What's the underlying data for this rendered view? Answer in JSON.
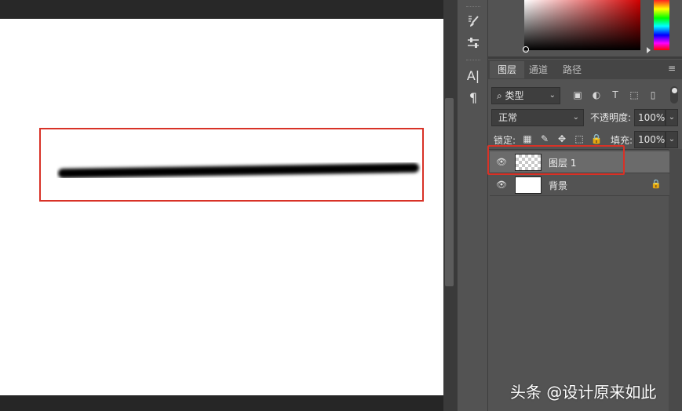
{
  "tool_strip": {
    "tools": [
      {
        "icon": "brush-settings-icon",
        "glyph": "🖌"
      },
      {
        "icon": "adjust-icon",
        "glyph": "⚙"
      },
      {
        "icon": "character-icon",
        "glyph": "A|"
      },
      {
        "icon": "paragraph-icon",
        "glyph": "¶"
      }
    ]
  },
  "panel_tabs": {
    "layers": "图层",
    "channels": "通道",
    "paths": "路径",
    "menu_glyph": "≡"
  },
  "filter": {
    "kind_label": "⌕ 类型",
    "icons": [
      "▣",
      "◐",
      "T",
      "⬚",
      "▯"
    ]
  },
  "blend": {
    "mode": "正常",
    "opacity_label": "不透明度:",
    "opacity_value": "100%"
  },
  "lock": {
    "label": "锁定:",
    "icons": [
      "▦",
      "✎",
      "✥",
      "⬚",
      "🔒"
    ],
    "fill_label": "填充:",
    "fill_value": "100%"
  },
  "layers": [
    {
      "name": "图层 1",
      "visible_glyph": "👁",
      "selected": true
    },
    {
      "name": "背景",
      "visible_glyph": "👁",
      "locked_glyph": "🔒",
      "selected": false
    }
  ],
  "dropdown_glyph": "⌄",
  "watermark": "头条 @设计原来如此",
  "colors": {
    "highlight": "#d83227",
    "panel": "#535353",
    "selected_layer": "#6b6b6b"
  }
}
